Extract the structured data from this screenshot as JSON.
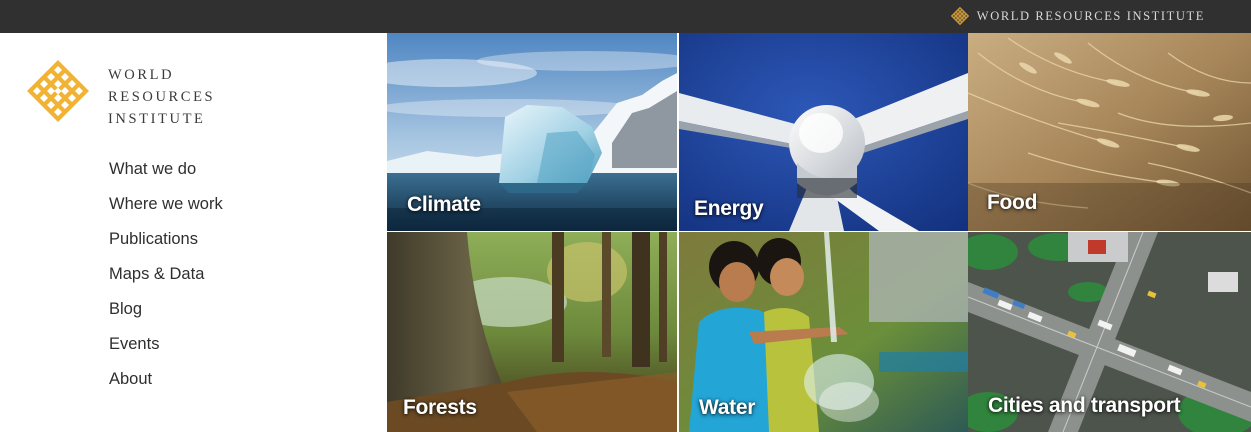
{
  "brand": {
    "topbar_name": "WORLD RESOURCES INSTITUTE",
    "logo_lines": [
      "WORLD",
      "RESOURCES",
      "INSTITUTE"
    ],
    "logo_color": "#f2b233",
    "logo_icon": "wri-knot-logo"
  },
  "nav": {
    "items": [
      {
        "label": "What we do"
      },
      {
        "label": "Where we work"
      },
      {
        "label": "Publications"
      },
      {
        "label": "Maps & Data"
      },
      {
        "label": "Blog"
      },
      {
        "label": "Events"
      },
      {
        "label": "About"
      }
    ]
  },
  "topics": [
    {
      "label": "Climate",
      "image": "iceberg-photo"
    },
    {
      "label": "Energy",
      "image": "wind-turbine-photo"
    },
    {
      "label": "Food",
      "image": "wheat-field-photo"
    },
    {
      "label": "Forests",
      "image": "forest-trees-photo"
    },
    {
      "label": "Water",
      "image": "children-water-photo"
    },
    {
      "label": "Cities and transport",
      "image": "city-intersection-photo"
    }
  ],
  "colors": {
    "topbar_bg": "#303030",
    "text": "#2f2f2f"
  }
}
